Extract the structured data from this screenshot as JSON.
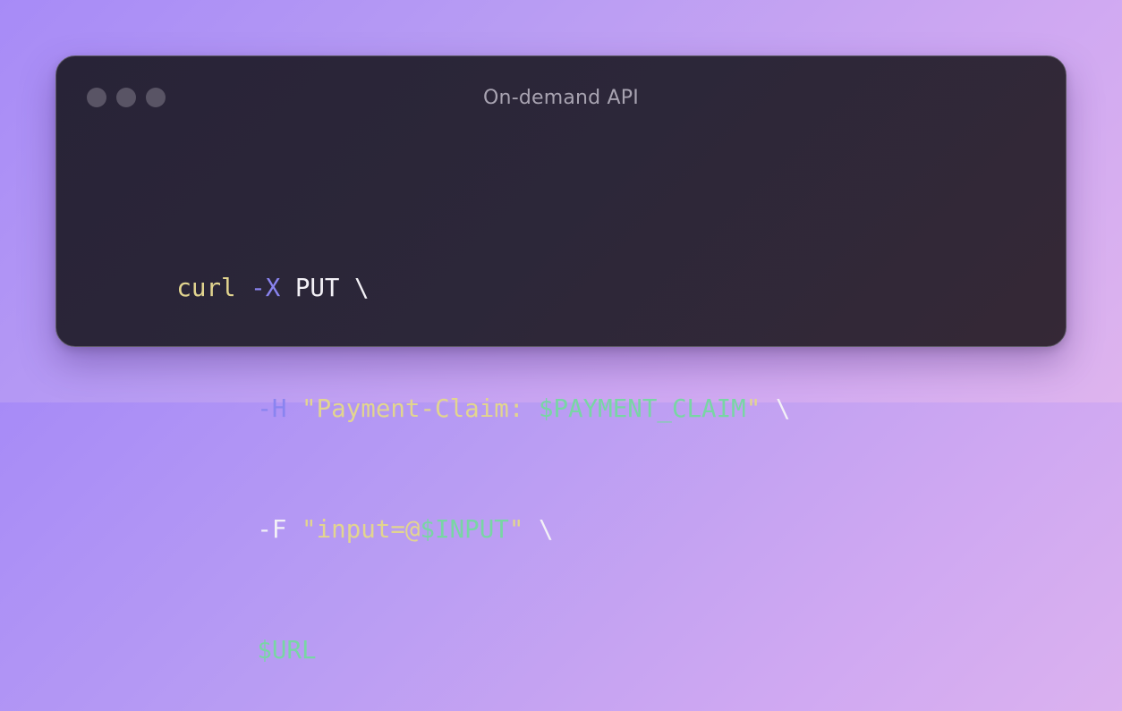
{
  "window": {
    "title": "On-demand API",
    "traffic_lights": [
      "close",
      "minimize",
      "maximize"
    ]
  },
  "code": {
    "lines": [
      [
        {
          "text": "curl",
          "role": "command"
        },
        {
          "text": " ",
          "role": "plain"
        },
        {
          "text": "-X",
          "role": "flag"
        },
        {
          "text": " PUT \\",
          "role": "plain"
        }
      ],
      [
        {
          "text": "-H",
          "role": "flag"
        },
        {
          "text": " ",
          "role": "plain"
        },
        {
          "text": "\"Payment-Claim: ",
          "role": "string"
        },
        {
          "text": "$PAYMENT_CLAIM",
          "role": "variable"
        },
        {
          "text": "\"",
          "role": "string"
        },
        {
          "text": " \\",
          "role": "plain"
        }
      ],
      [
        {
          "text": "-F",
          "role": "plain"
        },
        {
          "text": " ",
          "role": "plain"
        },
        {
          "text": "\"input=@",
          "role": "string"
        },
        {
          "text": "$INPUT",
          "role": "variable"
        },
        {
          "text": "\"",
          "role": "string"
        },
        {
          "text": " \\",
          "role": "plain"
        }
      ],
      [
        {
          "text": "$URL",
          "role": "variable"
        }
      ]
    ]
  },
  "colors": {
    "command": "#e2d58f",
    "flag": "#8a84f0",
    "string": "#e2d58f",
    "variable": "#78d6a4",
    "plain": "#f3f1f6"
  }
}
